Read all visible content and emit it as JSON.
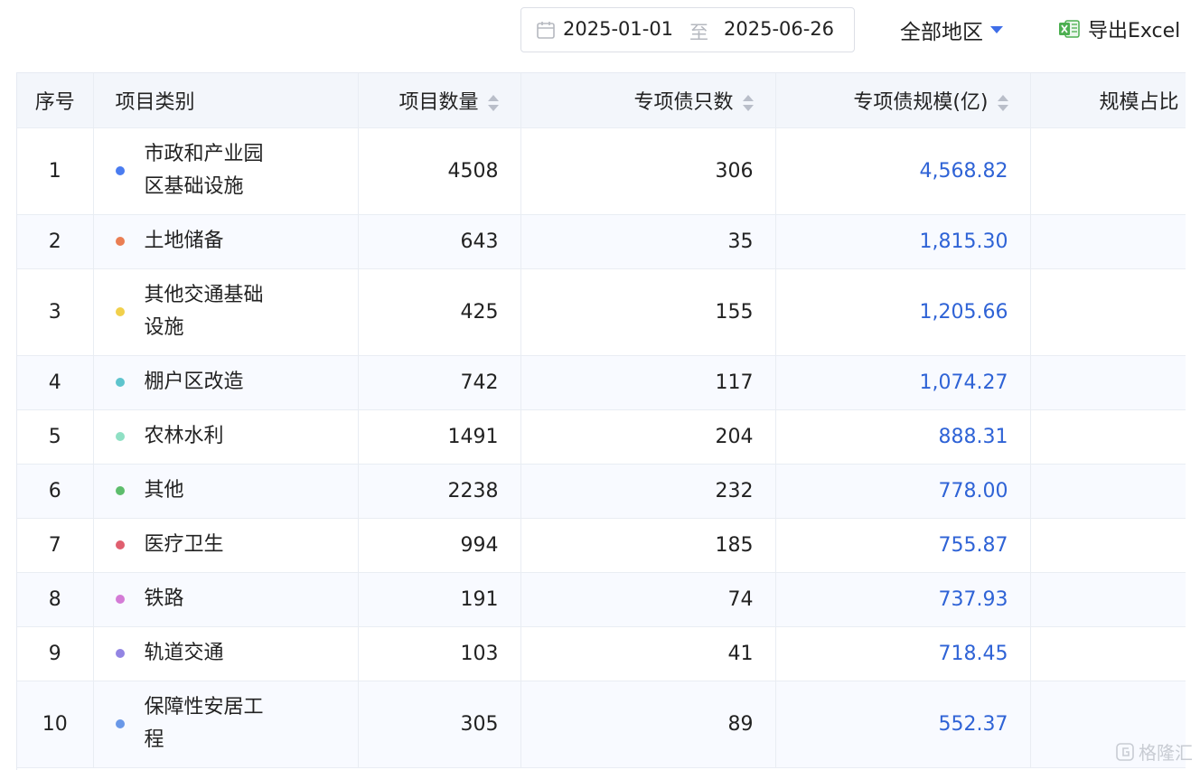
{
  "toolbar": {
    "date_start": "2025-01-01",
    "date_sep": "至",
    "date_end": "2025-06-26",
    "region_label": "全部地区",
    "export_label": "导出Excel"
  },
  "table": {
    "headers": {
      "index": "序号",
      "category": "项目类别",
      "count": "项目数量",
      "bond_count": "专项债只数",
      "scale": "专项债规模(亿)",
      "ratio": "规模占比"
    },
    "rows": [
      {
        "index": "1",
        "category": "市政和产业园区基础设施",
        "color": "#4a7cf0",
        "count": "4508",
        "bond_count": "306",
        "scale": "4,568.82"
      },
      {
        "index": "2",
        "category": "土地储备",
        "color": "#ea7e53",
        "count": "643",
        "bond_count": "35",
        "scale": "1,815.30"
      },
      {
        "index": "3",
        "category": "其他交通基础设施",
        "color": "#f1d04b",
        "count": "425",
        "bond_count": "155",
        "scale": "1,205.66"
      },
      {
        "index": "4",
        "category": "棚户区改造",
        "color": "#5ec4cd",
        "count": "742",
        "bond_count": "117",
        "scale": "1,074.27"
      },
      {
        "index": "5",
        "category": "农林水利",
        "color": "#8fe0c4",
        "count": "1491",
        "bond_count": "204",
        "scale": "888.31"
      },
      {
        "index": "6",
        "category": "其他",
        "color": "#5dbd6c",
        "count": "2238",
        "bond_count": "232",
        "scale": "778.00"
      },
      {
        "index": "7",
        "category": "医疗卫生",
        "color": "#e05f6f",
        "count": "994",
        "bond_count": "185",
        "scale": "755.87"
      },
      {
        "index": "8",
        "category": "铁路",
        "color": "#d47bd6",
        "count": "191",
        "bond_count": "74",
        "scale": "737.93"
      },
      {
        "index": "9",
        "category": "轨道交通",
        "color": "#9385e3",
        "count": "103",
        "bond_count": "41",
        "scale": "718.45"
      },
      {
        "index": "10",
        "category": "保障性安居工程",
        "color": "#6a98e8",
        "count": "305",
        "bond_count": "89",
        "scale": "552.37"
      }
    ]
  },
  "watermark": {
    "text": "格隆汇"
  },
  "colors": {
    "accent": "#2f63d6",
    "caret": "#3f6ee8",
    "header_bg": "#f3f6fb",
    "excel_green": "#4caf50"
  },
  "icons": {
    "date": "calendar-icon",
    "region": "caret-down-icon",
    "export": "excel-icon",
    "sort": "sort-icon"
  }
}
